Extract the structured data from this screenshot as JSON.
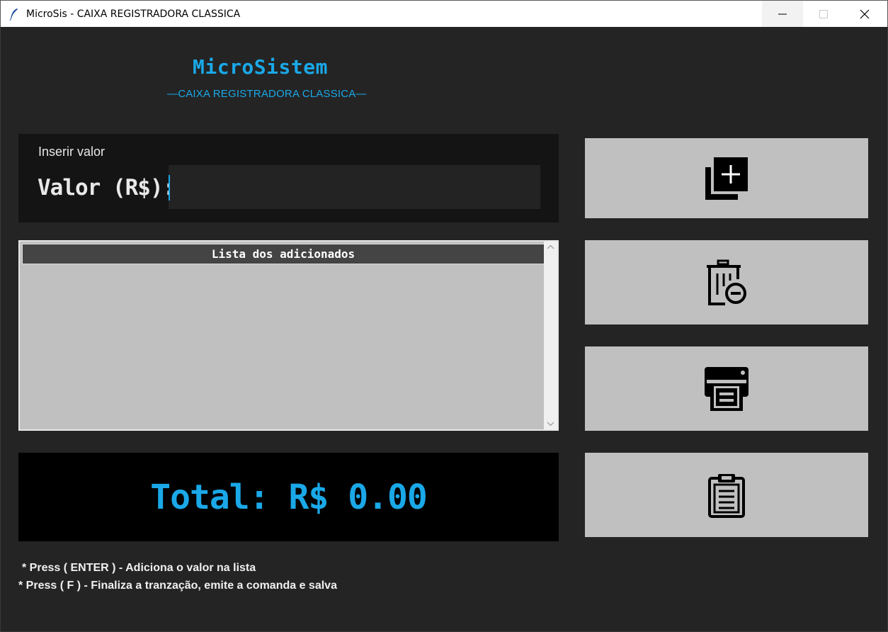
{
  "window": {
    "title": "MicroSis - CAIXA REGISTRADORA CLASSICA",
    "controls": [
      "minimize-icon",
      "maximize-icon",
      "close-icon"
    ]
  },
  "header": {
    "brand": "MicroSistem",
    "subtitle": "—CAIXA REGISTRADORA CLASSICA—"
  },
  "input_panel": {
    "title": "Inserir valor",
    "label": "Valor (R$):",
    "value": "",
    "placeholder": ""
  },
  "list": {
    "header": "Lista dos adicionados",
    "items": []
  },
  "total": {
    "text": "Total: R$ 0.00"
  },
  "hints": {
    "enter": "* Press ( ENTER ) - Adiciona o valor na lista",
    "f": "* Press ( F ) - Finaliza a tranzação, emite a comanda e salva"
  },
  "actions": [
    {
      "icon": "add-copy-icon"
    },
    {
      "icon": "trash-remove-icon"
    },
    {
      "icon": "printer-icon"
    },
    {
      "icon": "clipboard-icon"
    }
  ],
  "colors": {
    "background": "#242424",
    "accent": "#1aa8e8",
    "panel": "#141414",
    "button": "#c0c0c0",
    "total_bg": "#000000"
  }
}
